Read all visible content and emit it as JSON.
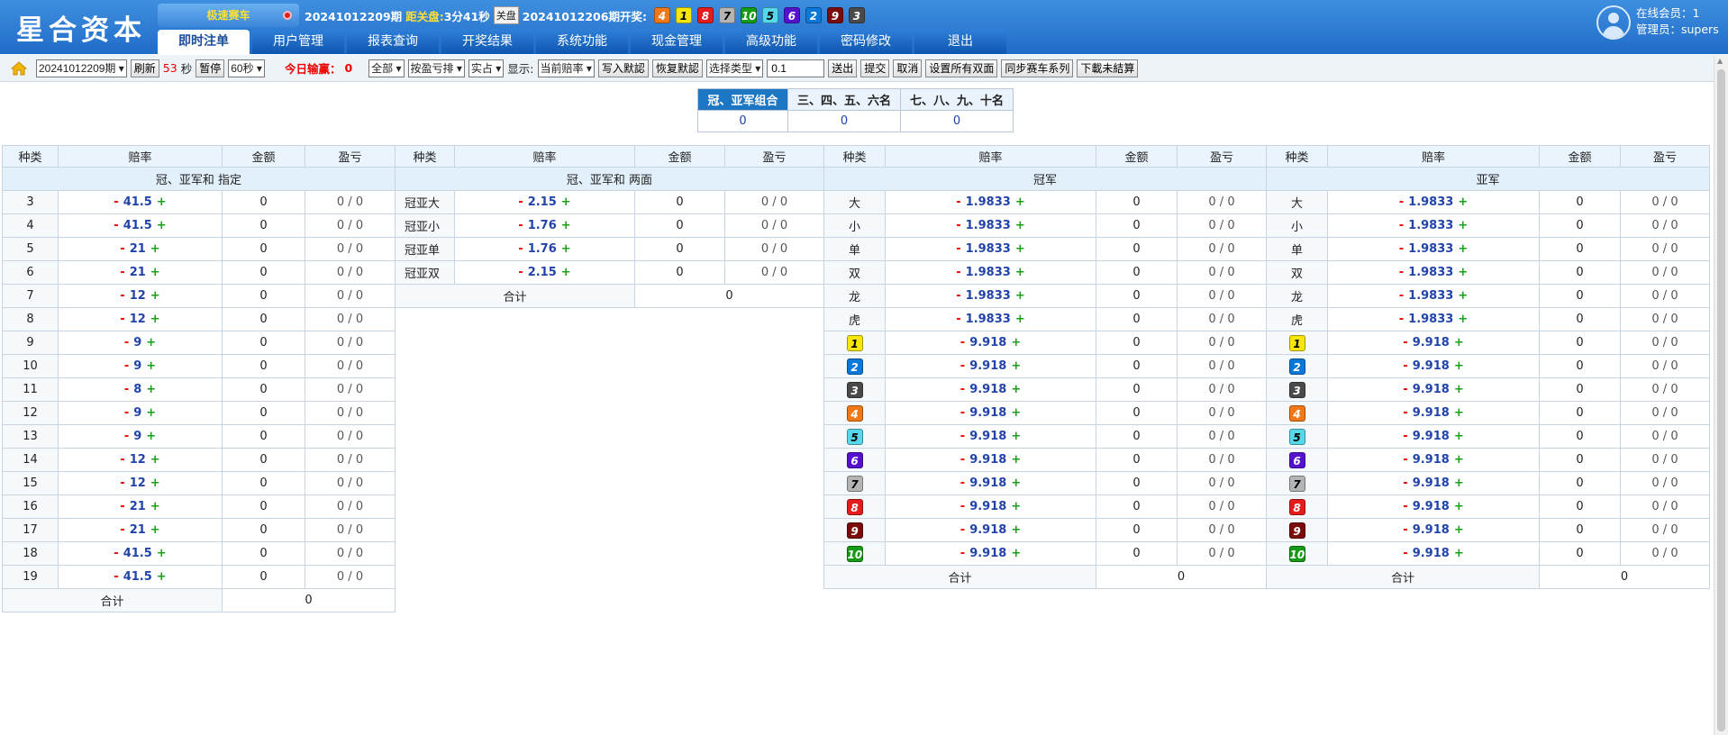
{
  "header": {
    "logo": "星合资本",
    "game_tab": "极速赛车",
    "period": "20241012209期",
    "close_label": "距关盘:",
    "close_time": "3分41秒",
    "close_btn": "关盘",
    "last_period": "20241012206期开奖:",
    "balls": [
      4,
      1,
      8,
      7,
      10,
      5,
      6,
      2,
      9,
      3
    ],
    "online_label": "在线会员：1",
    "admin_label": "管理员：supers"
  },
  "nav": [
    "即时注单",
    "用户管理",
    "报表查询",
    "开奖结果",
    "系统功能",
    "现金管理",
    "高级功能",
    "密码修改",
    "退出"
  ],
  "toolbar": {
    "period_select": "20241012209期",
    "refresh": "刷新",
    "countdown": "53",
    "sec": "秒",
    "pause": "暂停",
    "interval": "60秒",
    "today_label": "今日输赢：",
    "today_value": "0",
    "all": "全部",
    "sort": "按盈亏排",
    "actual": "实占",
    "show_label": "显示:",
    "odds_mode": "当前赔率",
    "write_default": "写入默認",
    "restore_default": "恢复默認",
    "choose_type": "选择类型",
    "input_value": "0.1",
    "send": "送出",
    "submit": "提交",
    "cancel": "取消",
    "set_all_double": "设置所有双面",
    "sync_series": "同步赛车系列",
    "download": "下載未結算"
  },
  "summary": {
    "headers": [
      "冠、亚军组合",
      "三、四、五、六名",
      "七、八、九、十名"
    ],
    "values": [
      "0",
      "0",
      "0"
    ]
  },
  "col_headers": [
    "种类",
    "赔率",
    "金额",
    "盈亏"
  ],
  "ball_colors": {
    "1": "#f6e60c",
    "2": "#0a78d8",
    "3": "#4a4a4a",
    "4": "#f07816",
    "5": "#56d8ea",
    "6": "#5512cc",
    "7": "#b4b4b4",
    "8": "#e41c1c",
    "9": "#7a0c0c",
    "10": "#179a16"
  },
  "ball_text_dark": [
    "1",
    "5",
    "7"
  ],
  "tables": {
    "t1": {
      "title": "冠、亚军和 指定",
      "rows": [
        {
          "k": "3",
          "o": "41.5",
          "a": "0",
          "p": "0 / 0"
        },
        {
          "k": "4",
          "o": "41.5",
          "a": "0",
          "p": "0 / 0"
        },
        {
          "k": "5",
          "o": "21",
          "a": "0",
          "p": "0 / 0"
        },
        {
          "k": "6",
          "o": "21",
          "a": "0",
          "p": "0 / 0"
        },
        {
          "k": "7",
          "o": "12",
          "a": "0",
          "p": "0 / 0"
        },
        {
          "k": "8",
          "o": "12",
          "a": "0",
          "p": "0 / 0"
        },
        {
          "k": "9",
          "o": "9",
          "a": "0",
          "p": "0 / 0"
        },
        {
          "k": "10",
          "o": "9",
          "a": "0",
          "p": "0 / 0"
        },
        {
          "k": "11",
          "o": "8",
          "a": "0",
          "p": "0 / 0"
        },
        {
          "k": "12",
          "o": "9",
          "a": "0",
          "p": "0 / 0"
        },
        {
          "k": "13",
          "o": "9",
          "a": "0",
          "p": "0 / 0"
        },
        {
          "k": "14",
          "o": "12",
          "a": "0",
          "p": "0 / 0"
        },
        {
          "k": "15",
          "o": "12",
          "a": "0",
          "p": "0 / 0"
        },
        {
          "k": "16",
          "o": "21",
          "a": "0",
          "p": "0 / 0"
        },
        {
          "k": "17",
          "o": "21",
          "a": "0",
          "p": "0 / 0"
        },
        {
          "k": "18",
          "o": "41.5",
          "a": "0",
          "p": "0 / 0"
        },
        {
          "k": "19",
          "o": "41.5",
          "a": "0",
          "p": "0 / 0"
        }
      ],
      "total_label": "合计",
      "total": "0"
    },
    "t2": {
      "title": "冠、亚军和 两面",
      "rows": [
        {
          "k": "冠亚大",
          "o": "2.15",
          "a": "0",
          "p": "0 / 0"
        },
        {
          "k": "冠亚小",
          "o": "1.76",
          "a": "0",
          "p": "0 / 0"
        },
        {
          "k": "冠亚单",
          "o": "1.76",
          "a": "0",
          "p": "0 / 0"
        },
        {
          "k": "冠亚双",
          "o": "2.15",
          "a": "0",
          "p": "0 / 0"
        }
      ],
      "total_label": "合计",
      "total": "0"
    },
    "t3": {
      "title": "冠军",
      "rows": [
        {
          "k": "大",
          "o": "1.9833",
          "a": "0",
          "p": "0 / 0"
        },
        {
          "k": "小",
          "o": "1.9833",
          "a": "0",
          "p": "0 / 0"
        },
        {
          "k": "单",
          "o": "1.9833",
          "a": "0",
          "p": "0 / 0"
        },
        {
          "k": "双",
          "o": "1.9833",
          "a": "0",
          "p": "0 / 0"
        },
        {
          "k": "龙",
          "o": "1.9833",
          "a": "0",
          "p": "0 / 0"
        },
        {
          "k": "虎",
          "o": "1.9833",
          "a": "0",
          "p": "0 / 0"
        },
        {
          "b": "1",
          "o": "9.918",
          "a": "0",
          "p": "0 / 0"
        },
        {
          "b": "2",
          "o": "9.918",
          "a": "0",
          "p": "0 / 0"
        },
        {
          "b": "3",
          "o": "9.918",
          "a": "0",
          "p": "0 / 0"
        },
        {
          "b": "4",
          "o": "9.918",
          "a": "0",
          "p": "0 / 0"
        },
        {
          "b": "5",
          "o": "9.918",
          "a": "0",
          "p": "0 / 0"
        },
        {
          "b": "6",
          "o": "9.918",
          "a": "0",
          "p": "0 / 0"
        },
        {
          "b": "7",
          "o": "9.918",
          "a": "0",
          "p": "0 / 0"
        },
        {
          "b": "8",
          "o": "9.918",
          "a": "0",
          "p": "0 / 0"
        },
        {
          "b": "9",
          "o": "9.918",
          "a": "0",
          "p": "0 / 0"
        },
        {
          "b": "10",
          "o": "9.918",
          "a": "0",
          "p": "0 / 0"
        }
      ],
      "total_label": "合计",
      "total": "0"
    },
    "t4": {
      "title": "亚军",
      "rows": [
        {
          "k": "大",
          "o": "1.9833",
          "a": "0",
          "p": "0 / 0"
        },
        {
          "k": "小",
          "o": "1.9833",
          "a": "0",
          "p": "0 / 0"
        },
        {
          "k": "单",
          "o": "1.9833",
          "a": "0",
          "p": "0 / 0"
        },
        {
          "k": "双",
          "o": "1.9833",
          "a": "0",
          "p": "0 / 0"
        },
        {
          "k": "龙",
          "o": "1.9833",
          "a": "0",
          "p": "0 / 0"
        },
        {
          "k": "虎",
          "o": "1.9833",
          "a": "0",
          "p": "0 / 0"
        },
        {
          "b": "1",
          "o": "9.918",
          "a": "0",
          "p": "0 / 0"
        },
        {
          "b": "2",
          "o": "9.918",
          "a": "0",
          "p": "0 / 0"
        },
        {
          "b": "3",
          "o": "9.918",
          "a": "0",
          "p": "0 / 0"
        },
        {
          "b": "4",
          "o": "9.918",
          "a": "0",
          "p": "0 / 0"
        },
        {
          "b": "5",
          "o": "9.918",
          "a": "0",
          "p": "0 / 0"
        },
        {
          "b": "6",
          "o": "9.918",
          "a": "0",
          "p": "0 / 0"
        },
        {
          "b": "7",
          "o": "9.918",
          "a": "0",
          "p": "0 / 0"
        },
        {
          "b": "8",
          "o": "9.918",
          "a": "0",
          "p": "0 / 0"
        },
        {
          "b": "9",
          "o": "9.918",
          "a": "0",
          "p": "0 / 0"
        },
        {
          "b": "10",
          "o": "9.918",
          "a": "0",
          "p": "0 / 0"
        }
      ],
      "total_label": "合计",
      "total": "0"
    }
  },
  "icons": {
    "home": "home-icon"
  }
}
